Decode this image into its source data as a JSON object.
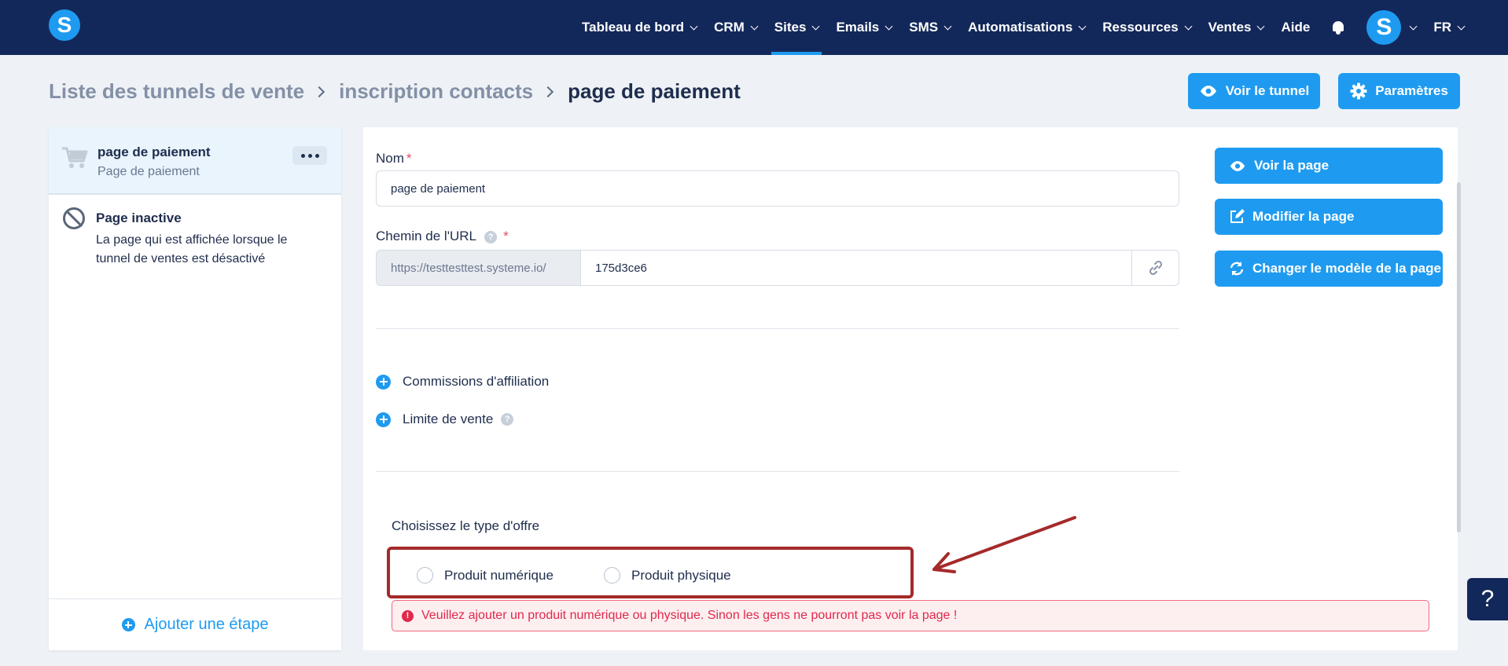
{
  "app": {
    "logo_letter": "S",
    "avatar_letter": "S",
    "accent_color": "#1e9bf0",
    "nav_bg": "#13285a"
  },
  "nav": {
    "items": [
      {
        "label": "Tableau de bord",
        "has_dropdown": true
      },
      {
        "label": "CRM",
        "has_dropdown": true
      },
      {
        "label": "Sites",
        "has_dropdown": true,
        "active": true
      },
      {
        "label": "Emails",
        "has_dropdown": true
      },
      {
        "label": "SMS",
        "has_dropdown": true
      },
      {
        "label": "Automatisations",
        "has_dropdown": true
      },
      {
        "label": "Ressources",
        "has_dropdown": true
      },
      {
        "label": "Ventes",
        "has_dropdown": true
      },
      {
        "label": "Aide",
        "has_dropdown": false
      }
    ],
    "language": "FR"
  },
  "breadcrumb": [
    "Liste des tunnels de vente",
    "inscription contacts",
    "page de paiement"
  ],
  "header_buttons": {
    "view_funnel": "Voir le tunnel",
    "settings": "Paramètres"
  },
  "sidebar": {
    "active_step": {
      "title": "page de paiement",
      "subtitle": "Page de paiement",
      "icon": "cart-icon"
    },
    "inactive_page": {
      "title": "Page inactive",
      "description": "La page qui est affichée lorsque le tunnel de ventes est désactivé"
    },
    "add_step": "Ajouter une étape"
  },
  "form": {
    "name_label": "Nom",
    "name_required": "*",
    "name_value": "page de paiement",
    "url_label": "Chemin de l'URL",
    "url_required": "*",
    "url_help": "?",
    "url_prefix": "https://testtesttest.systeme.io/",
    "url_slug": "175d3ce6",
    "affiliate_commissions": "Commissions d'affiliation",
    "sales_limit": "Limite de vente",
    "sales_limit_help": "?",
    "offer_type_label": "Choisissez le type d'offre",
    "offer_options": [
      "Produit numérique",
      "Produit physique"
    ],
    "alert_icon": "!",
    "alert": "Veuillez ajouter un produit numérique ou physique. Sinon les gens ne pourront pas voir la page !"
  },
  "page_actions": {
    "view_page": "Voir la page",
    "edit_page": "Modifier la page",
    "change_template": "Changer le modèle de la page"
  },
  "annotation": {
    "arrow_color": "#a52a2a"
  },
  "help_widget": "?"
}
